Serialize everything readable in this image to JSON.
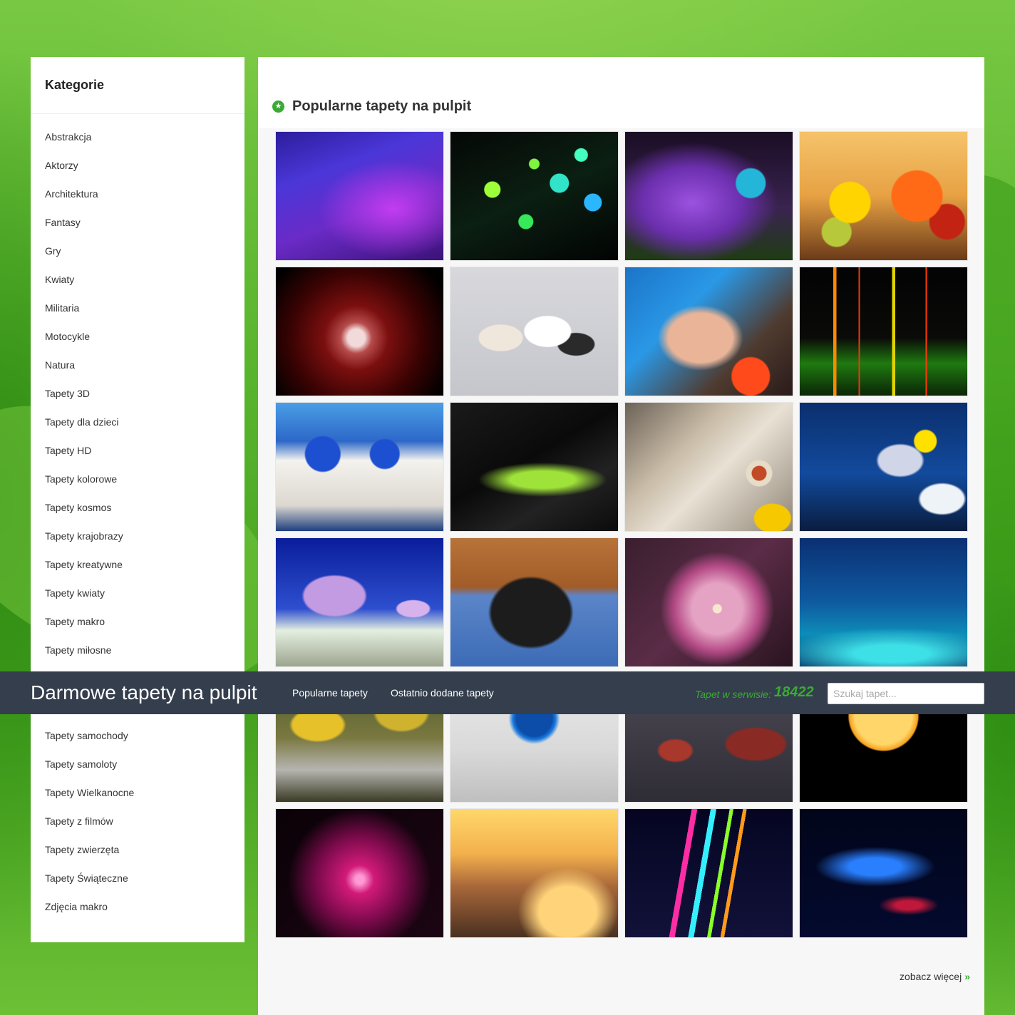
{
  "sidebar": {
    "title": "Kategorie",
    "categories": [
      "Abstrakcja",
      "Aktorzy",
      "Architektura",
      "Fantasy",
      "Gry",
      "Kwiaty",
      "Militaria",
      "Motocykle",
      "Natura",
      "Tapety 3D",
      "Tapety dla dzieci",
      "Tapety HD",
      "Tapety kolorowe",
      "Tapety kosmos",
      "Tapety krajobrazy",
      "Tapety kreatywne",
      "Tapety kwiaty",
      "Tapety makro",
      "Tapety miłosne",
      "",
      "",
      "Tapety samochody",
      "Tapety samoloty",
      "Tapety Wielkanocne",
      "Tapety z filmów",
      "Tapety zwierzęta",
      "Tapety Świąteczne",
      "Zdjęcia makro"
    ]
  },
  "main": {
    "section_title": "Popularne tapety na pulpit",
    "see_more": "zobacz więcej",
    "see_more_icon": "double-chevron-right-icon",
    "section_icon": "star-circle-icon",
    "thumbnails": [
      "abstract-purple",
      "green-bubbles",
      "butterfly-flowers",
      "autumn-fruits",
      "red-moon",
      "kittens",
      "blue-haired-woman",
      "equalizer",
      "santorini",
      "green-curve",
      "bird-closeup",
      "aquarium-fish",
      "purple-tree",
      "puppy",
      "pink-fractal-flower",
      "blue-waves",
      "autumn-stream",
      "windows-logo",
      "halo-soldiers",
      "moon-silhouette",
      "pink-swirl",
      "seaside-town",
      "neon-ribbons",
      "blue-smoke"
    ]
  },
  "navbar": {
    "brand": "Darmowe tapety na pulpit",
    "links": [
      "Popularne tapety",
      "Ostatnio dodane tapety"
    ],
    "count_label": "Tapet w serwisie:",
    "count_value": "18422",
    "search_placeholder": "Szukaj tapet..."
  },
  "colors": {
    "accent": "#3aaa35",
    "navbar_bg": "#343e4c",
    "background_green": "#52b02a"
  }
}
